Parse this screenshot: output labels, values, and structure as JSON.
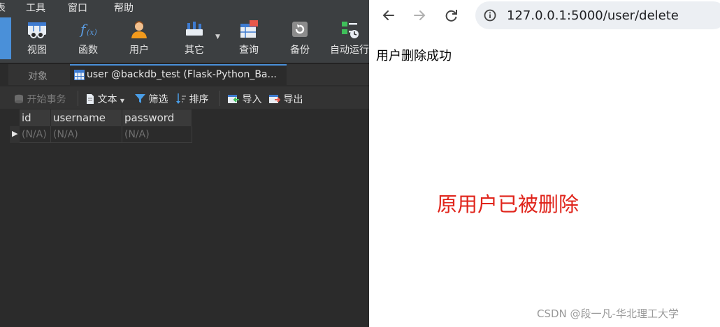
{
  "menu": [
    "表",
    "工具",
    "窗口",
    "帮助"
  ],
  "toolbar": {
    "items": [
      {
        "label": "视图",
        "icon": "view-icon"
      },
      {
        "label": "函数",
        "icon": "function-icon"
      },
      {
        "label": "用户",
        "icon": "user-icon"
      },
      {
        "label": "其它",
        "icon": "other-icon"
      },
      {
        "label": "查询",
        "icon": "query-icon"
      },
      {
        "label": "备份",
        "icon": "backup-icon"
      },
      {
        "label": "自动运行",
        "icon": "autorun-icon"
      }
    ]
  },
  "tabs": {
    "objects": "对象",
    "table": "user @backdb_test (Flask-Python_Ba..."
  },
  "grid_toolbar": {
    "begin_transaction": "开始事务",
    "text": "文本",
    "filter": "筛选",
    "sort": "排序",
    "import": "导入",
    "export": "导出"
  },
  "table": {
    "columns": [
      "id",
      "username",
      "password"
    ],
    "rows": [
      [
        "(N/A)",
        "(N/A)",
        "(N/A)"
      ]
    ]
  },
  "browser": {
    "url": "127.0.0.1:5000/user/delete",
    "message": "用户删除成功",
    "annotation": "原用户已被删除",
    "watermark": "CSDN @段一凡-华北理工大学"
  },
  "colors": {
    "app_bg": "#2b2b2b",
    "accent": "#4a90d9",
    "annotation_red": "#e0241b"
  }
}
